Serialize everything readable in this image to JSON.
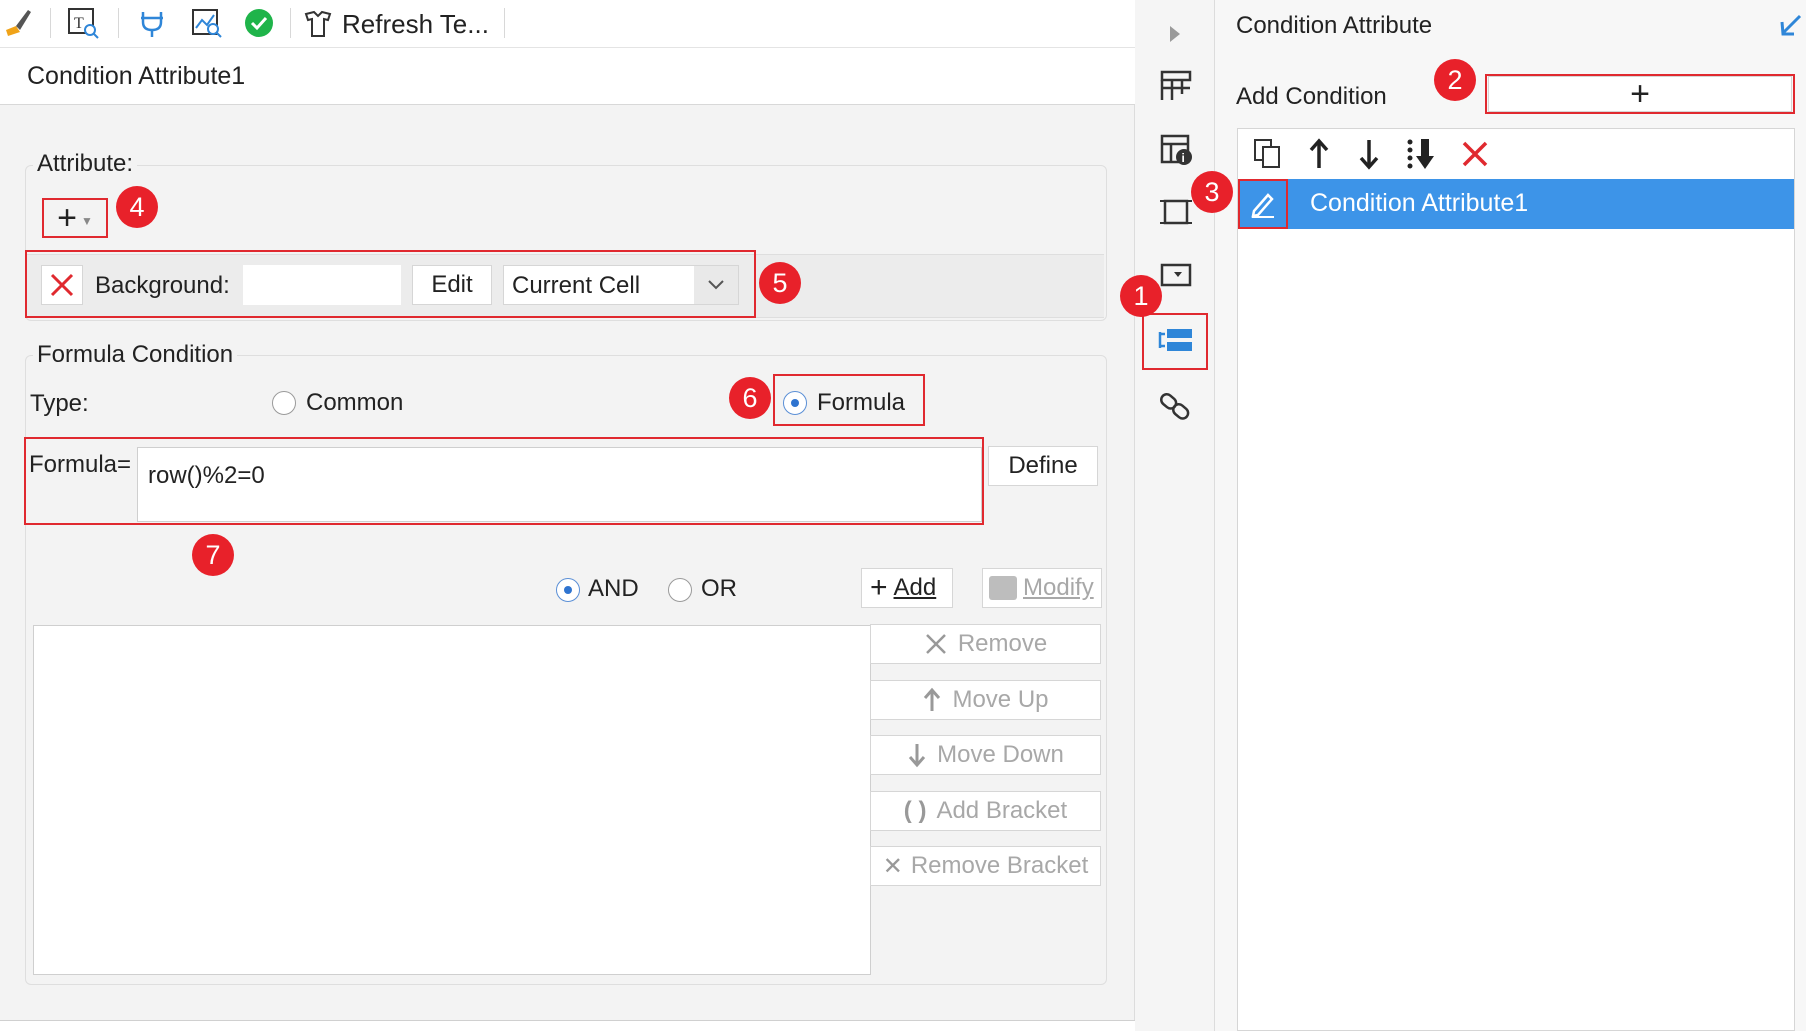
{
  "toolbar": {
    "refresh_label": "Refresh Te..."
  },
  "left": {
    "tab_title": "Condition Attribute1",
    "attribute_label": "Attribute:",
    "background_label": "Background:",
    "background_value": "",
    "edit_label": "Edit",
    "scope_value": "Current Cell",
    "formula_condition_label": "Formula Condition",
    "type_label": "Type:",
    "type_common": "Common",
    "type_formula": "Formula",
    "formula_label": "Formula=",
    "formula_value": "row()%2=0",
    "define_label": "Define",
    "and_label": "AND",
    "or_label": "OR",
    "add_label": "Add",
    "modify_label": "Modify",
    "remove_label": "Remove",
    "move_up_label": "Move Up",
    "move_down_label": "Move Down",
    "add_bracket_label": "Add Bracket",
    "remove_bracket_label": "Remove Bracket"
  },
  "right": {
    "panel_title": "Condition Attribute",
    "add_condition_label": "Add Condition",
    "list_items": [
      "Condition Attribute1"
    ]
  },
  "badges": [
    "1",
    "2",
    "3",
    "4",
    "5",
    "6",
    "7"
  ],
  "colors": {
    "accent": "#3d94e8",
    "badge_red": "#e8212a",
    "highlight_red": "#e0292f",
    "icon_blue": "#2f86d8"
  }
}
